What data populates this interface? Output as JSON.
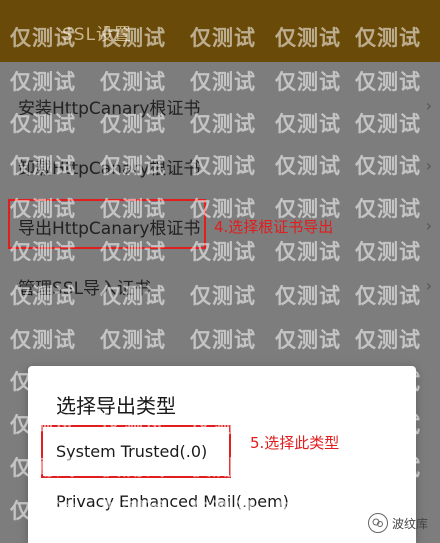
{
  "header": {
    "title": "SSL设置"
  },
  "list": {
    "items": [
      {
        "label": "安装HttpCanary根证书",
        "chevron": "›"
      },
      {
        "label": "卸载HttpCanary根证书",
        "chevron": "›"
      },
      {
        "label": "导出HttpCanary根证书",
        "chevron": "›"
      },
      {
        "label": "管理SSL导入证书",
        "chevron": "›"
      }
    ]
  },
  "annotations": {
    "step4": "4.选择根证书导出",
    "step5": "5.选择此类型"
  },
  "dialog": {
    "title": "选择导出类型",
    "options": [
      {
        "label": "System Trusted(.0)"
      },
      {
        "label": "Privacy Enhanced Mail(.pem)"
      }
    ]
  },
  "watermark": {
    "text": "仅测试"
  },
  "brand": {
    "text": "波纹库"
  },
  "colors": {
    "header": "#6a4a08",
    "overlay": "#7d7d7d",
    "annotation": "#e11d1d"
  }
}
